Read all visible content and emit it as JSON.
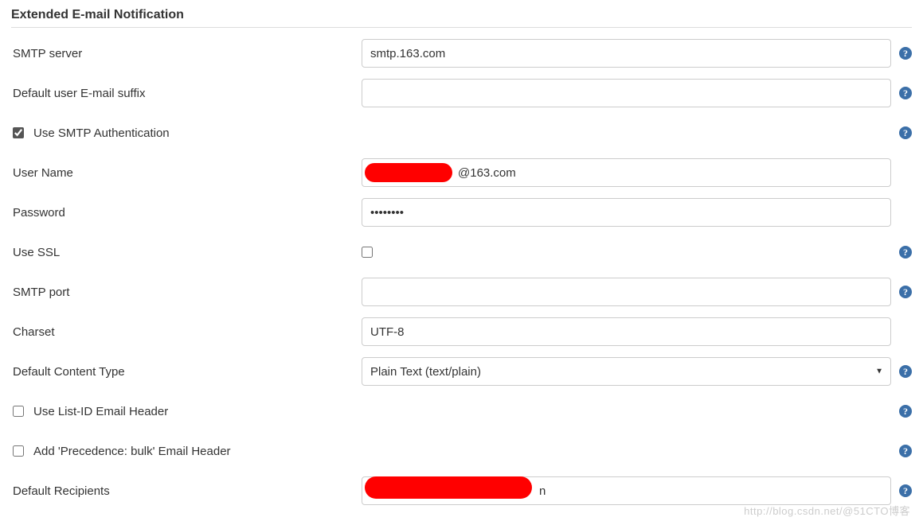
{
  "section_title": "Extended E-mail Notification",
  "fields": {
    "smtp_server": {
      "label": "SMTP server",
      "value": "smtp.163.com"
    },
    "default_suffix": {
      "label": "Default user E-mail suffix",
      "value": ""
    },
    "use_smtp_auth": {
      "label": "Use SMTP Authentication",
      "checked": true
    },
    "user_name": {
      "label": "User Name",
      "value": "@163.com",
      "redacted_prefix": true
    },
    "password": {
      "label": "Password",
      "value": "••••••••"
    },
    "use_ssl": {
      "label": "Use SSL",
      "checked": false
    },
    "smtp_port": {
      "label": "SMTP port",
      "value": ""
    },
    "charset": {
      "label": "Charset",
      "value": "UTF-8"
    },
    "default_content_type": {
      "label": "Default Content Type",
      "value": "Plain Text (text/plain)"
    },
    "use_list_id": {
      "label": "Use List-ID Email Header",
      "checked": false
    },
    "add_precedence": {
      "label": "Add 'Precedence: bulk' Email Header",
      "checked": false
    },
    "default_recipients": {
      "label": "Default Recipients",
      "value": "n",
      "redacted_prefix": true
    }
  },
  "watermark": "http://blog.csdn.net/@51CTO博客"
}
